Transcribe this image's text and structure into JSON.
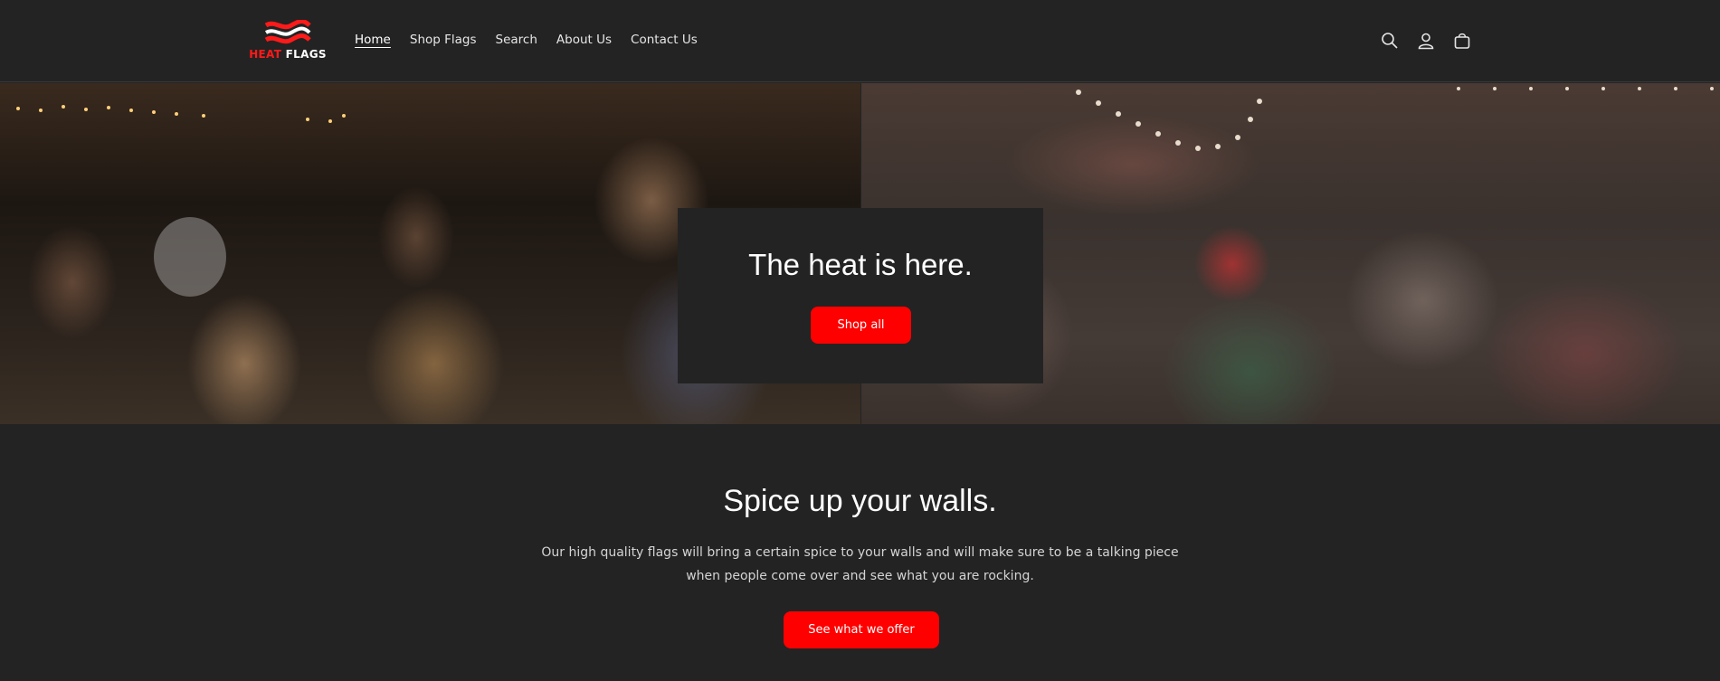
{
  "brand": {
    "logo_icon": "heat-flags-logo",
    "logo_heat": "HEAT",
    "logo_flags": "FLAGS",
    "accent_color": "#ff0000"
  },
  "nav": {
    "items": [
      {
        "label": "Home",
        "active": true
      },
      {
        "label": "Shop Flags",
        "active": false
      },
      {
        "label": "Search",
        "active": false
      },
      {
        "label": "About Us",
        "active": false
      },
      {
        "label": "Contact Us",
        "active": false
      }
    ]
  },
  "header_icons": [
    "search-icon",
    "account-icon",
    "cart-icon"
  ],
  "hero": {
    "title": "The heat is here.",
    "button_label": "Shop all"
  },
  "section": {
    "title": "Spice up your walls.",
    "text": "Our high quality flags will bring a certain spice to your walls and will make sure to be a talking piece when people come over and see what you are rocking.",
    "button_label": "See what we offer"
  }
}
